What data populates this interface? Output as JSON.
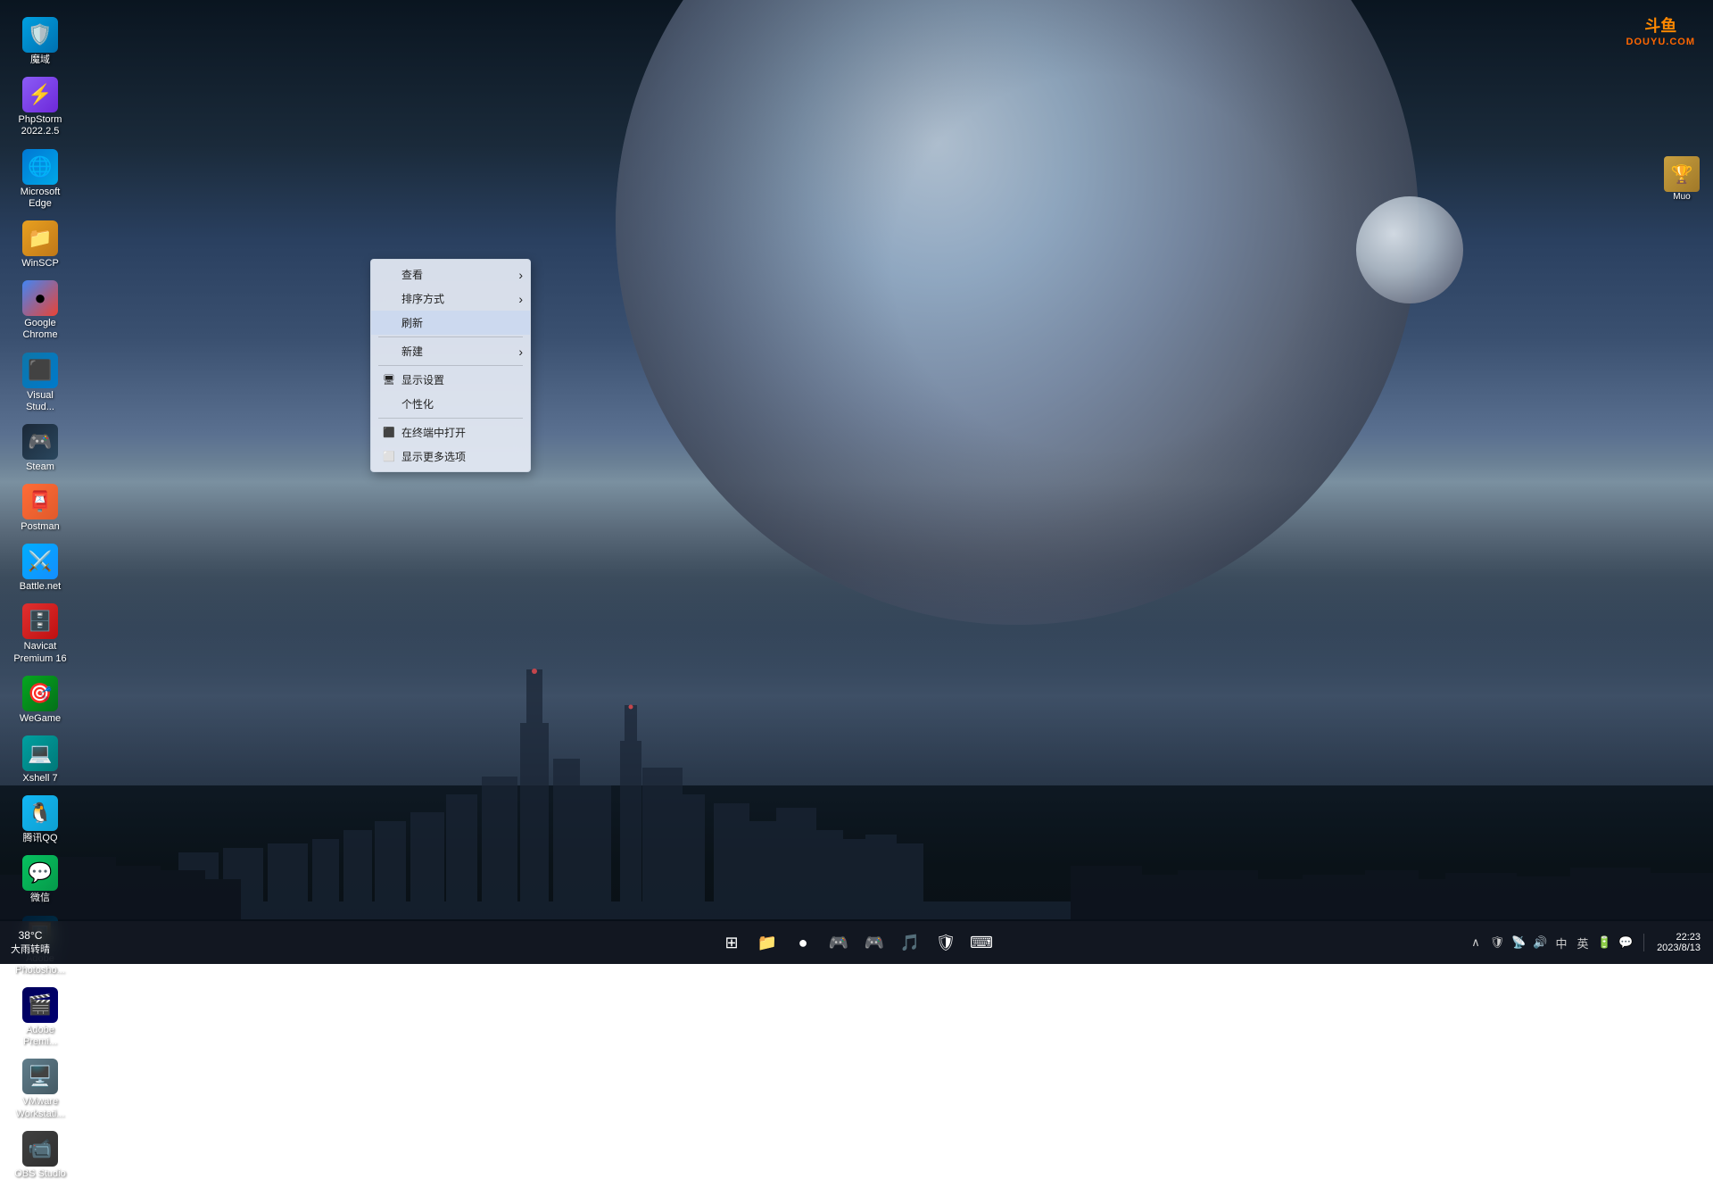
{
  "desktop": {
    "icons": [
      {
        "id": "icon-360",
        "label": "魔域",
        "emoji": "🛡️",
        "colorClass": "icon-360"
      },
      {
        "id": "icon-phpstorm",
        "label": "PhpStorm\n2022.2.5",
        "emoji": "⚡",
        "colorClass": "icon-phpstorm"
      },
      {
        "id": "icon-edge",
        "label": "Microsoft\nEdge",
        "emoji": "🌐",
        "colorClass": "icon-edge"
      },
      {
        "id": "icon-winSCP",
        "label": "WinSCP",
        "emoji": "📁",
        "colorClass": "icon-winSCP"
      },
      {
        "id": "icon-chrome",
        "label": "Google\nChrome",
        "emoji": "●",
        "colorClass": "icon-chrome"
      },
      {
        "id": "icon-vscode",
        "label": "Visual\nStud...",
        "emoji": "⬛",
        "colorClass": "icon-vscode"
      },
      {
        "id": "icon-steam",
        "label": "Steam",
        "emoji": "🎮",
        "colorClass": "icon-steam"
      },
      {
        "id": "icon-postman",
        "label": "Postman",
        "emoji": "📮",
        "colorClass": "icon-postman"
      },
      {
        "id": "icon-battlenet",
        "label": "Battle.net",
        "emoji": "⚔️",
        "colorClass": "icon-battlenet"
      },
      {
        "id": "icon-navicat",
        "label": "Navicat\nPremium 16",
        "emoji": "🗄️",
        "colorClass": "icon-navicat"
      },
      {
        "id": "icon-wegame",
        "label": "WeGame",
        "emoji": "🎯",
        "colorClass": "icon-wegame"
      },
      {
        "id": "icon-shell",
        "label": "Xshell 7",
        "emoji": "💻",
        "colorClass": "icon-shell"
      },
      {
        "id": "icon-qq",
        "label": "腾讯QQ",
        "emoji": "🐧",
        "colorClass": "icon-qq"
      },
      {
        "id": "icon-wechat",
        "label": "微信",
        "emoji": "💬",
        "colorClass": "icon-wechat"
      },
      {
        "id": "icon-ps",
        "label": "Adobe\nPhotosho...",
        "emoji": "🖼️",
        "colorClass": "icon-ps"
      },
      {
        "id": "icon-pr",
        "label": "Adobe\nPremi...",
        "emoji": "🎬",
        "colorClass": "icon-pr"
      },
      {
        "id": "icon-vmware",
        "label": "VMware\nWorkstati...",
        "emoji": "🖥️",
        "colorClass": "icon-vmware"
      },
      {
        "id": "icon-obs",
        "label": "OBS Studio",
        "emoji": "📹",
        "colorClass": "icon-obs"
      }
    ]
  },
  "contextMenu": {
    "items": [
      {
        "id": "view",
        "label": "查看",
        "hasArrow": true,
        "disabled": false,
        "icon": ""
      },
      {
        "id": "sort",
        "label": "排序方式",
        "hasArrow": true,
        "disabled": false,
        "icon": ""
      },
      {
        "id": "refresh",
        "label": "刷新",
        "hasArrow": false,
        "disabled": false,
        "icon": "",
        "isActive": true
      },
      {
        "id": "separator1",
        "type": "separator"
      },
      {
        "id": "new",
        "label": "新建",
        "hasArrow": true,
        "disabled": false,
        "icon": ""
      },
      {
        "id": "separator2",
        "type": "separator"
      },
      {
        "id": "display",
        "label": "显示设置",
        "hasArrow": false,
        "disabled": false,
        "icon": "🖥"
      },
      {
        "id": "personalize",
        "label": "个性化",
        "hasArrow": false,
        "disabled": false,
        "icon": ""
      },
      {
        "id": "separator3",
        "type": "separator"
      },
      {
        "id": "terminal",
        "label": "在终端中打开",
        "hasArrow": false,
        "disabled": false,
        "icon": "⬛"
      },
      {
        "id": "more",
        "label": "显示更多选项",
        "hasArrow": false,
        "disabled": false,
        "icon": "⬜"
      }
    ]
  },
  "taskbar": {
    "weatherTemp": "38°C",
    "weatherDesc": "大雨转晴",
    "time": "22:23",
    "date": "2023/8/13",
    "centerIcons": [
      {
        "id": "start",
        "emoji": "⊞",
        "label": "Start"
      },
      {
        "id": "files",
        "emoji": "📁",
        "label": "File Explorer"
      },
      {
        "id": "chrome",
        "emoji": "●",
        "label": "Chrome"
      },
      {
        "id": "games",
        "emoji": "🎮",
        "label": "Games"
      },
      {
        "id": "steam",
        "emoji": "🎮",
        "label": "Steam"
      },
      {
        "id": "music",
        "emoji": "🎵",
        "label": "Music"
      },
      {
        "id": "security",
        "emoji": "🛡",
        "label": "Security"
      },
      {
        "id": "input",
        "emoji": "⌨",
        "label": "Input"
      }
    ],
    "trayIcons": [
      {
        "id": "expand",
        "emoji": "∧"
      },
      {
        "id": "antivirus",
        "emoji": "🛡"
      },
      {
        "id": "network",
        "emoji": "📡"
      },
      {
        "id": "audio",
        "emoji": "🔊"
      },
      {
        "id": "keyboard1",
        "emoji": "中"
      },
      {
        "id": "keyboard2",
        "emoji": "英"
      },
      {
        "id": "battery",
        "emoji": "🔋"
      },
      {
        "id": "notification",
        "emoji": "💬"
      }
    ]
  },
  "douyu": {
    "logoTop": "斗鱼",
    "logoBottom": "DOUYU.COM"
  }
}
